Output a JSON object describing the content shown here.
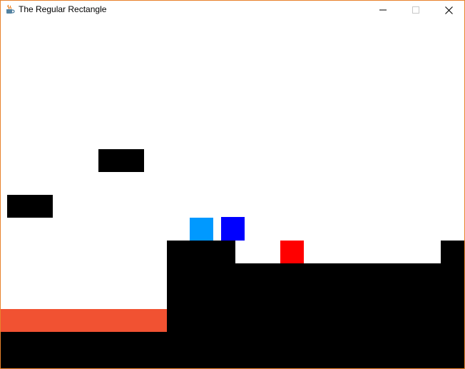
{
  "window": {
    "title": "The Regular Rectangle",
    "app_icon": "java-coffee-cup-icon",
    "controls": {
      "minimize_icon": "minimize-icon",
      "maximize_icon": "maximize-icon",
      "close_icon": "close-icon"
    },
    "border_color": "#e8822c"
  },
  "game": {
    "colors": {
      "background": "#ffffff",
      "terrain": "#000000",
      "lava": "#f15232",
      "player_light_blue": "#0099ff",
      "player_blue": "#0000ff",
      "goal_red": "#ff0000"
    },
    "entities": [
      {
        "name": "floating-platform-upper",
        "type": "platform"
      },
      {
        "name": "floating-platform-left",
        "type": "platform"
      },
      {
        "name": "player-light-blue-square",
        "type": "player"
      },
      {
        "name": "player-blue-square",
        "type": "player"
      },
      {
        "name": "red-square",
        "type": "goal"
      },
      {
        "name": "lava-pool",
        "type": "hazard"
      },
      {
        "name": "ground-left",
        "type": "terrain"
      },
      {
        "name": "raised-ledge",
        "type": "terrain"
      },
      {
        "name": "ground-right",
        "type": "terrain"
      },
      {
        "name": "right-pillar",
        "type": "terrain"
      }
    ]
  }
}
